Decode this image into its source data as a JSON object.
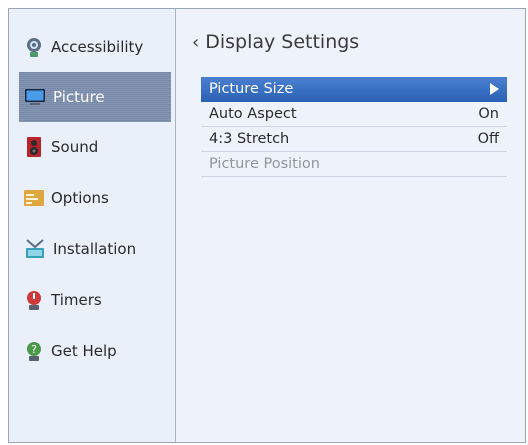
{
  "sidebar": {
    "items": [
      {
        "label": "Accessibility",
        "icon": "accessibility-icon"
      },
      {
        "label": "Picture",
        "icon": "tv-icon"
      },
      {
        "label": "Sound",
        "icon": "speaker-icon"
      },
      {
        "label": "Options",
        "icon": "options-icon"
      },
      {
        "label": "Installation",
        "icon": "antenna-icon"
      },
      {
        "label": "Timers",
        "icon": "timer-icon"
      },
      {
        "label": "Get Help",
        "icon": "help-icon"
      }
    ],
    "selected": "Picture"
  },
  "main": {
    "title": "Display Settings",
    "back_icon": "chevron-left-icon",
    "rows": [
      {
        "label": "Picture Size",
        "value": "",
        "selected": true
      },
      {
        "label": "Auto Aspect",
        "value": "On"
      },
      {
        "label": "4:3 Stretch",
        "value": "Off"
      },
      {
        "label": "Picture Position",
        "value": "",
        "disabled": true
      }
    ]
  },
  "colors": {
    "selection_bar": "#2c63b8",
    "sidebar_selected": "#7d8fae",
    "background": "#eef3fb"
  }
}
